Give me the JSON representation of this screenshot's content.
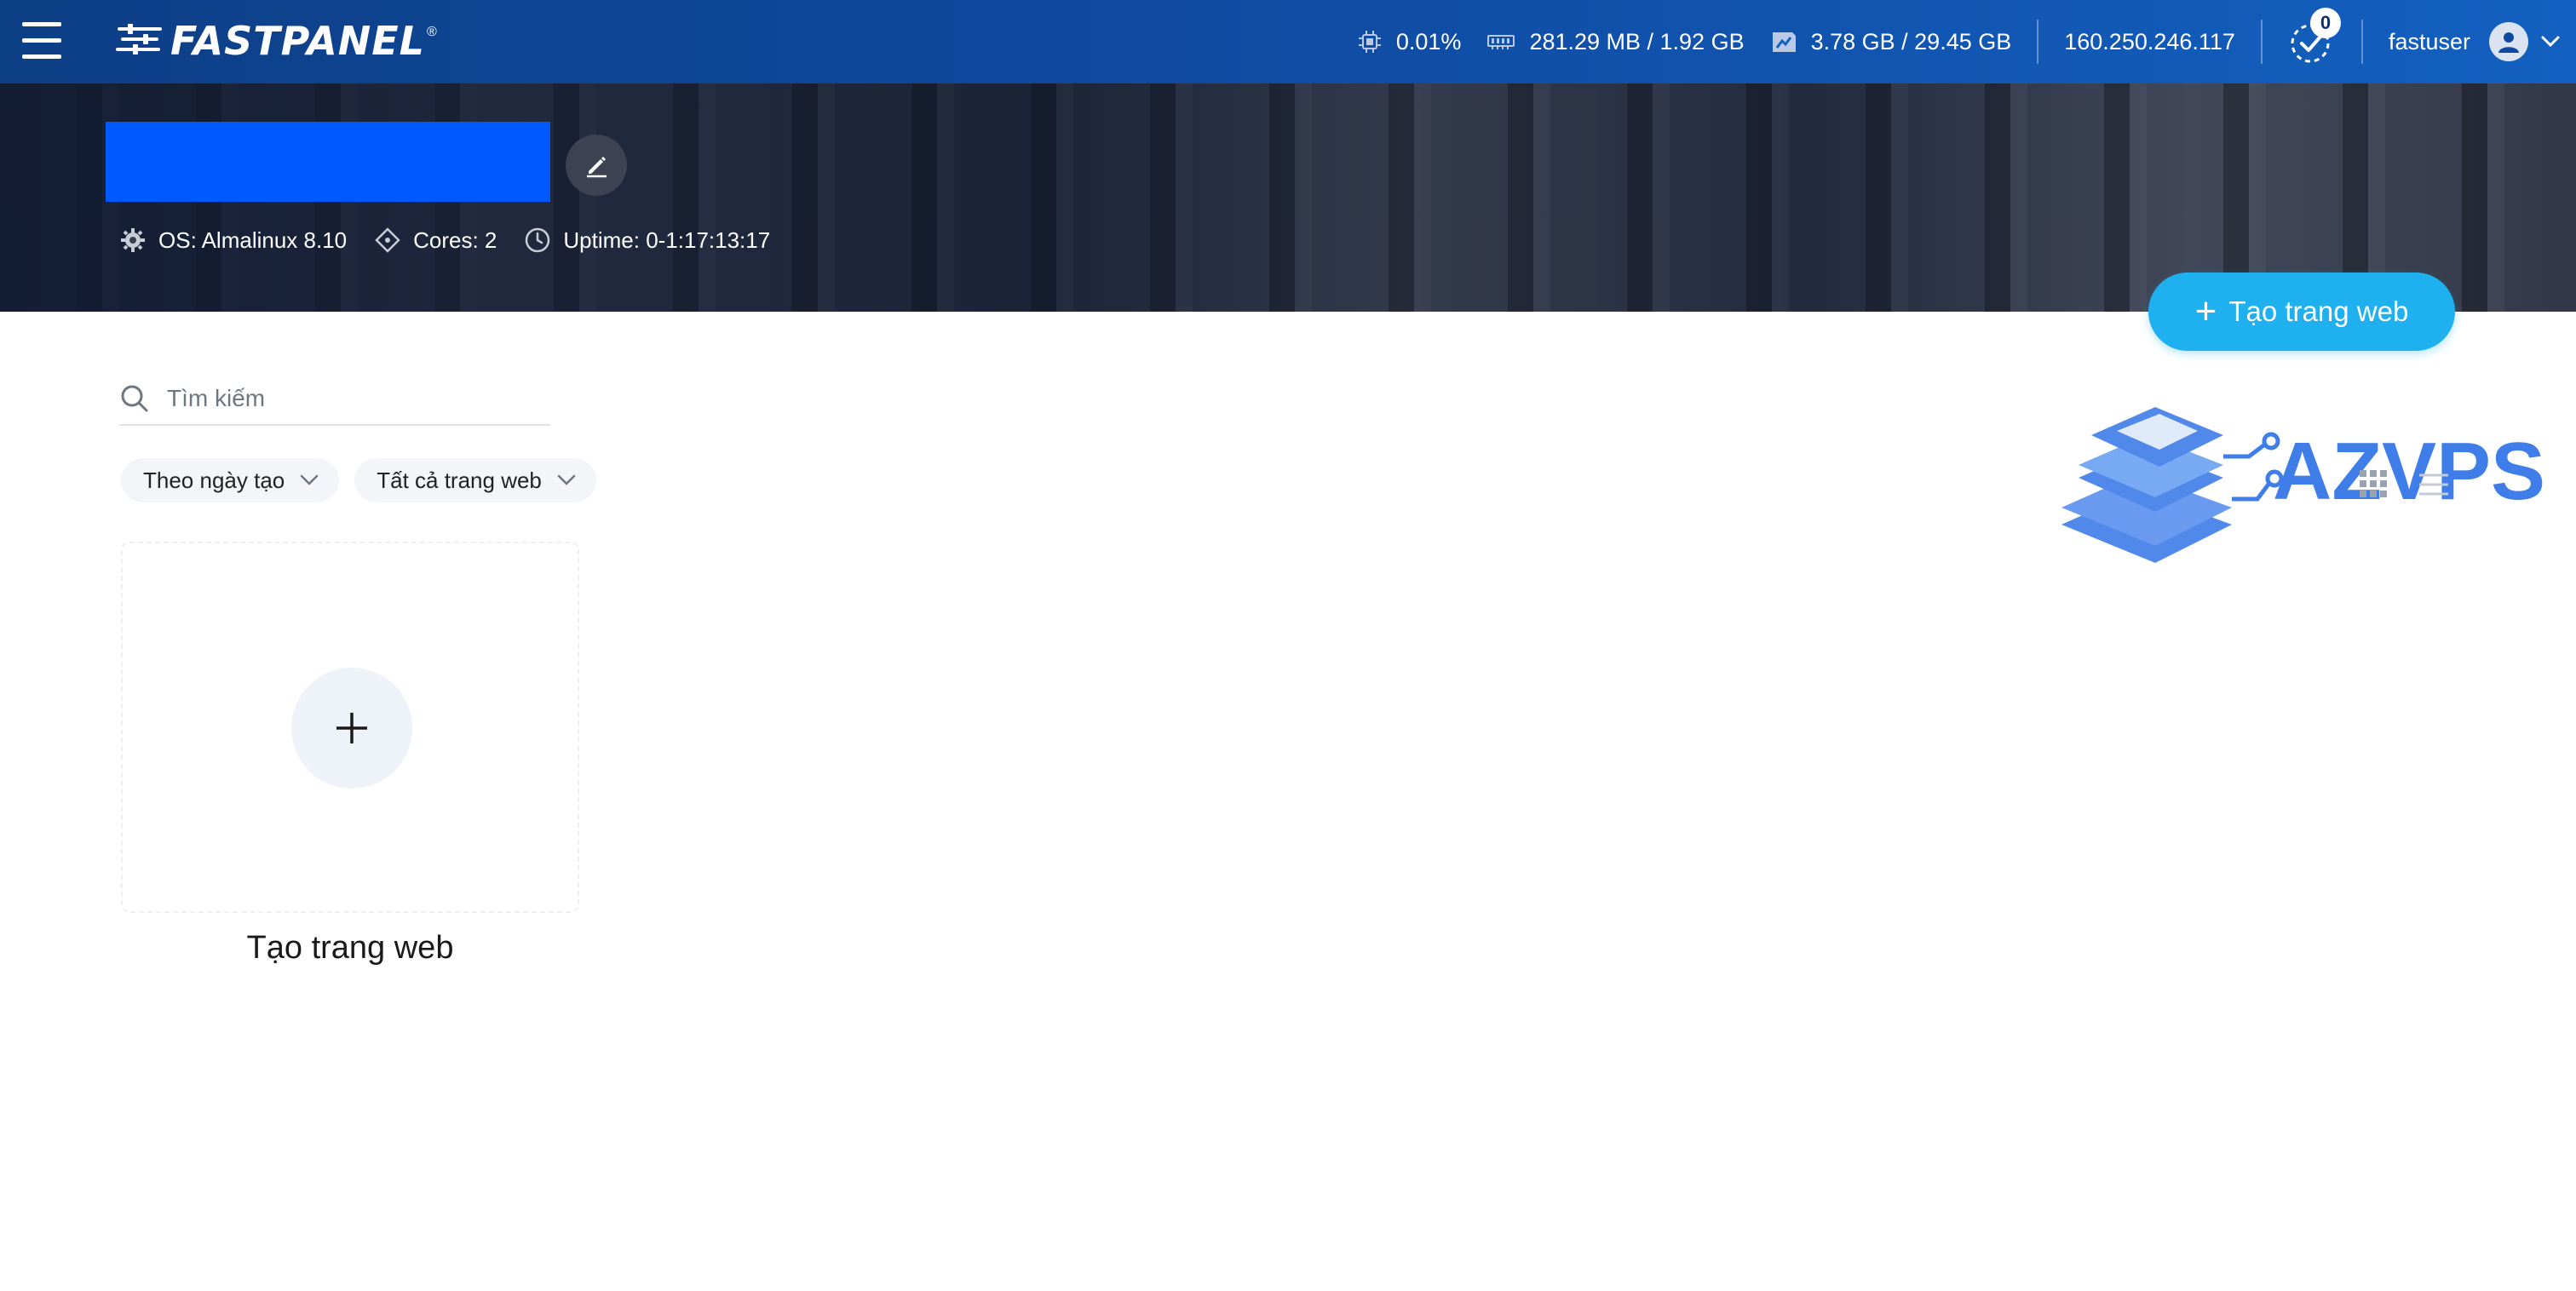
{
  "topbar": {
    "brand": "FASTPANEL",
    "brand_reg": "®",
    "cpu": "0.01%",
    "ram": "281.29 MB / 1.92 GB",
    "disk": "3.78 GB / 29.45 GB",
    "ip": "160.250.246.117",
    "tasks_count": "0",
    "username": "fastuser"
  },
  "server": {
    "os": "OS: Almalinux 8.10",
    "cores": "Cores: 2",
    "uptime": "Uptime: 0-1:17:13:17"
  },
  "actions": {
    "create_site": "Tạo trang web"
  },
  "search": {
    "placeholder": "Tìm kiếm"
  },
  "filters": {
    "sort": "Theo ngày tạo",
    "scope": "Tất cả trang web"
  },
  "add_card": {
    "label": "Tạo trang web"
  },
  "watermark": {
    "text": "AZVPS"
  },
  "colors": {
    "topbar": "#1360c0",
    "accent_button": "#1eb0ef",
    "name_block": "#0059ff",
    "watermark": "#3f7de8"
  }
}
